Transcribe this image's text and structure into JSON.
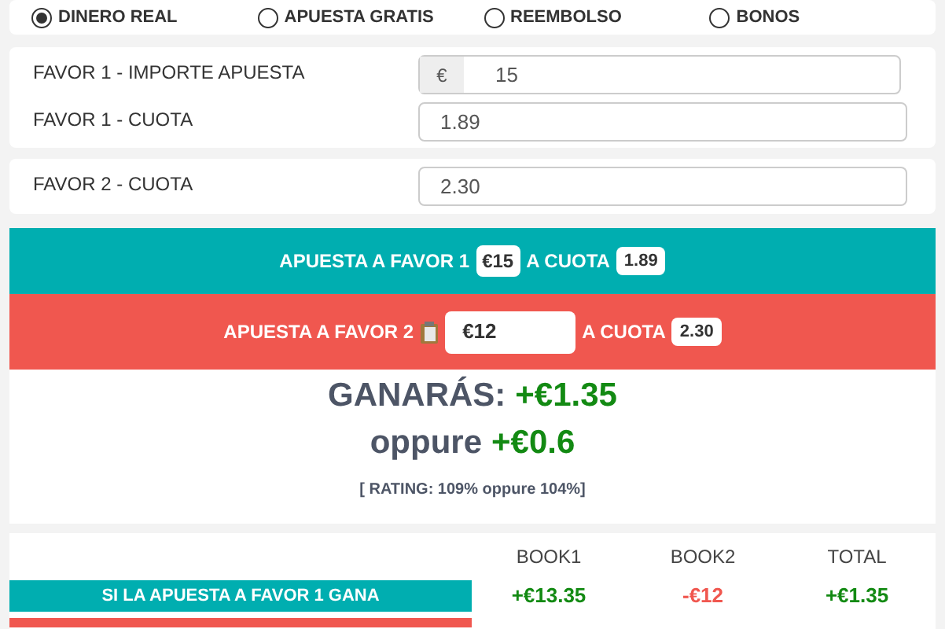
{
  "bet_types": [
    {
      "label": "DINERO REAL",
      "selected": true
    },
    {
      "label": "APUESTA GRATIS",
      "selected": false
    },
    {
      "label": "REEMBOLSO",
      "selected": false
    },
    {
      "label": "BONOS",
      "selected": false
    }
  ],
  "stake_card": {
    "stake_label": "FAVOR 1 - IMPORTE APUESTA",
    "currency": "€",
    "stake_value": "15",
    "odds_label": "FAVOR 1 - CUOTA",
    "odds_value": "1.89"
  },
  "odds2_card": {
    "label": "FAVOR 2 - CUOTA",
    "value": "2.30"
  },
  "bet1": {
    "label": "APUESTA A FAVOR 1",
    "stake": "€15",
    "odds_label": "A CUOTA",
    "odds": "1.89"
  },
  "bet2": {
    "label": "APUESTA A FAVOR 2",
    "stake": "€12",
    "odds_label": "A CUOTA",
    "odds": "2.30"
  },
  "result": {
    "win_label": "GANARÁS:",
    "win_value": "+€1.35",
    "alt_label": "oppure",
    "alt_value": "+€0.6",
    "rating": "[ RATING: 109% oppure 104%]"
  },
  "table": {
    "columns": [
      "BOOK1",
      "BOOK2",
      "TOTAL"
    ],
    "rows": [
      {
        "label": "SI LA APUESTA A FAVOR 1 GANA",
        "values": [
          {
            "text": "+€13.35",
            "positive": true
          },
          {
            "text": "-€12",
            "positive": false
          },
          {
            "text": "+€1.35",
            "positive": true
          }
        ]
      }
    ]
  }
}
